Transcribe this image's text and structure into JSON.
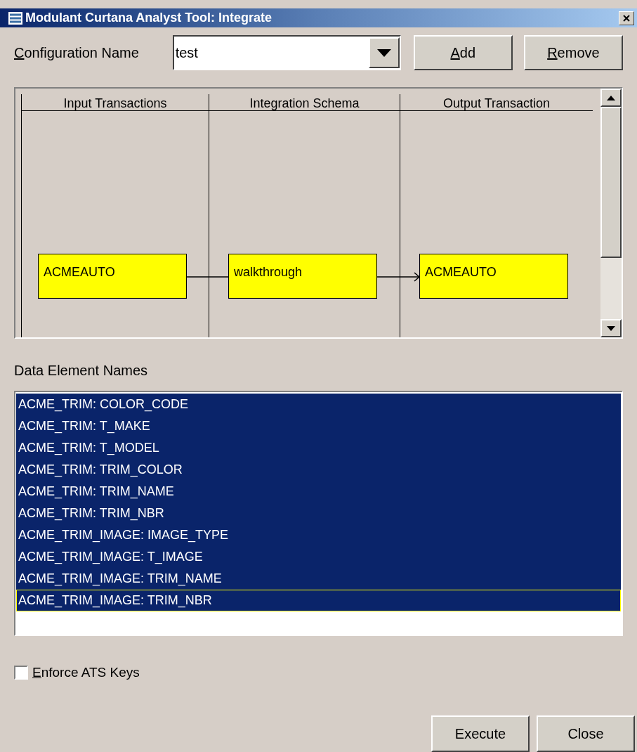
{
  "window": {
    "title": "Modulant Curtana Analyst Tool: Integrate"
  },
  "configuration": {
    "label": "Configuration Name",
    "mnemonic": true,
    "value": "test"
  },
  "config_buttons": [
    {
      "label": "Add",
      "mnemonic": true
    },
    {
      "label": "Remove",
      "mnemonic": true
    }
  ],
  "diagram": {
    "lanes": [
      {
        "title": "Input Transactions",
        "node": "ACMEAUTO"
      },
      {
        "title": "Integration Schema",
        "node": "walkthrough"
      },
      {
        "title": "Output Transaction",
        "node": "ACMEAUTO"
      }
    ],
    "connectors": [
      {
        "kind": "line"
      },
      {
        "kind": "arrow"
      }
    ]
  },
  "data_elements": {
    "label": "Data Element Names",
    "items": [
      {
        "text": "ACME_TRIM: COLOR_CODE",
        "selected": true,
        "focused": false
      },
      {
        "text": "ACME_TRIM: T_MAKE",
        "selected": true,
        "focused": false
      },
      {
        "text": "ACME_TRIM: T_MODEL",
        "selected": true,
        "focused": false
      },
      {
        "text": "ACME_TRIM: TRIM_COLOR",
        "selected": true,
        "focused": false
      },
      {
        "text": "ACME_TRIM: TRIM_NAME",
        "selected": true,
        "focused": false
      },
      {
        "text": "ACME_TRIM: TRIM_NBR",
        "selected": true,
        "focused": false
      },
      {
        "text": "ACME_TRIM_IMAGE: IMAGE_TYPE",
        "selected": true,
        "focused": false
      },
      {
        "text": "ACME_TRIM_IMAGE: T_IMAGE",
        "selected": true,
        "focused": false
      },
      {
        "text": "ACME_TRIM_IMAGE: TRIM_NAME",
        "selected": true,
        "focused": false
      },
      {
        "text": "ACME_TRIM_IMAGE: TRIM_NBR",
        "selected": true,
        "focused": true
      }
    ]
  },
  "enforce_keys": {
    "label": "Enforce ATS Keys",
    "mnemonic": true,
    "checked": false
  },
  "footer_buttons": [
    {
      "label": "Execute"
    },
    {
      "label": "Close"
    }
  ]
}
